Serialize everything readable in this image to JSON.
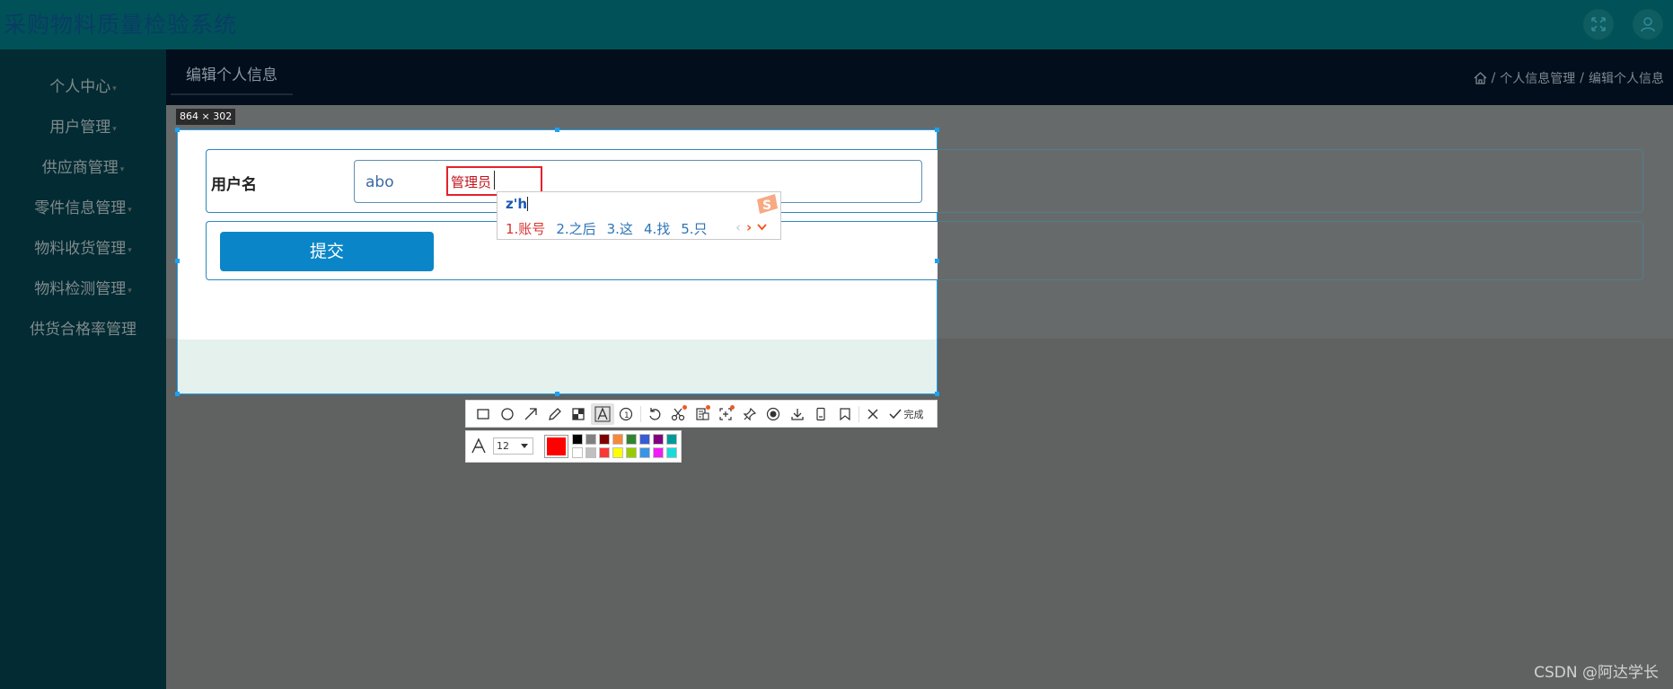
{
  "app": {
    "title": "采购物料质量检验系统"
  },
  "header_icons": [
    "fullscreen-icon",
    "user-icon"
  ],
  "sidebar": {
    "items": [
      {
        "label": "个人中心",
        "has_caret": true
      },
      {
        "label": "用户管理",
        "has_caret": true
      },
      {
        "label": "供应商管理",
        "has_caret": true
      },
      {
        "label": "零件信息管理",
        "has_caret": true
      },
      {
        "label": "物料收货管理",
        "has_caret": true
      },
      {
        "label": "物料检测管理",
        "has_caret": true
      },
      {
        "label": "供货合格率管理",
        "has_caret": false
      }
    ]
  },
  "content_header": {
    "tab": "编辑个人信息",
    "breadcrumb": {
      "sep": "/",
      "level1": "个人信息管理",
      "level2": "编辑个人信息"
    }
  },
  "form": {
    "username_label": "用户名",
    "username_value": "abo",
    "submit_label": "提交"
  },
  "capture": {
    "size_label": "864 × 302",
    "annotation_text": "管理员"
  },
  "ime": {
    "composition": "z'h",
    "candidates": [
      "1.账号",
      "2.之后",
      "3.这",
      "4.找",
      "5.只"
    ]
  },
  "toolbar": {
    "tools": [
      "rectangle-icon",
      "ellipse-icon",
      "arrow-icon",
      "pencil-icon",
      "mosaic-icon",
      "text-icon",
      "number-icon",
      "undo-icon",
      "cutout-icon",
      "ocr-icon",
      "translate-icon",
      "pin-icon",
      "record-icon",
      "download-icon",
      "long-screenshot-icon",
      "bookmark-icon"
    ],
    "cancel": "close-icon",
    "done_label": "完成"
  },
  "text_options": {
    "font_size": "12",
    "current_color": "#ff0000",
    "palette": [
      "#000000",
      "#808080",
      "#800000",
      "#f7883a",
      "#308430",
      "#385ad3",
      "#800080",
      "#009999",
      "#ffffff",
      "#c0c0c0",
      "#fb3838",
      "#ffff00",
      "#99cc00",
      "#3894e4",
      "#f31bf3",
      "#16dcdc"
    ]
  },
  "watermark": "CSDN @阿达学长"
}
